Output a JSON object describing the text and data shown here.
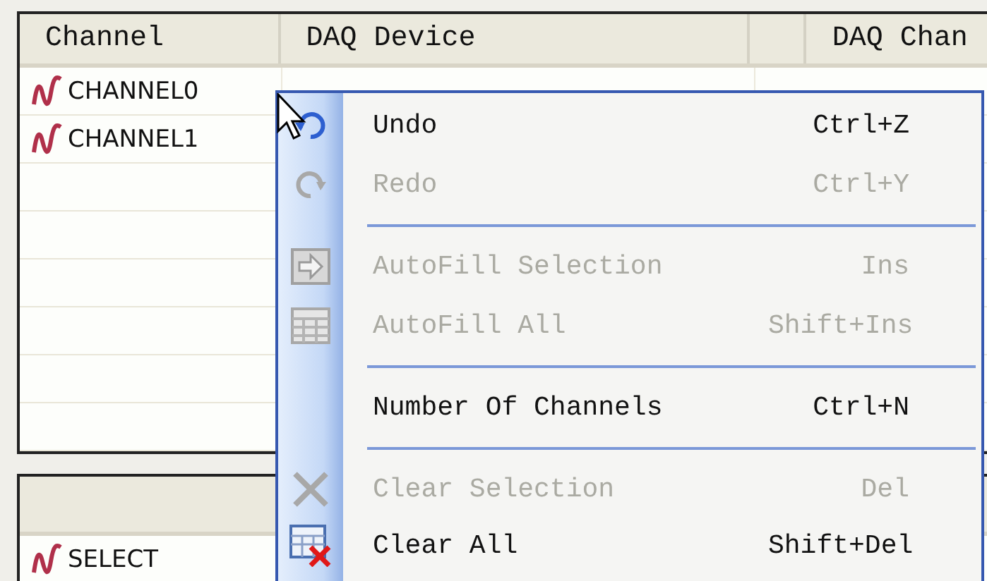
{
  "channel_table": {
    "columns": [
      "Channel",
      "DAQ Device",
      "",
      "DAQ Chan"
    ],
    "rows": [
      {
        "channel": "CHANNEL0"
      },
      {
        "channel": "CHANNEL1"
      }
    ]
  },
  "select_table": {
    "rows": [
      {
        "channel": "SELECT"
      }
    ]
  },
  "context_menu": {
    "items": [
      {
        "kind": "item",
        "label": "Undo",
        "shortcut": "Ctrl+Z",
        "disabled": false
      },
      {
        "kind": "item",
        "label": "Redo",
        "shortcut": "Ctrl+Y",
        "disabled": true
      },
      {
        "kind": "separator"
      },
      {
        "kind": "item",
        "label": "AutoFill Selection",
        "shortcut": "Ins",
        "disabled": true
      },
      {
        "kind": "item",
        "label": "AutoFill All",
        "shortcut": "Shift+Ins",
        "disabled": true
      },
      {
        "kind": "separator"
      },
      {
        "kind": "item",
        "label": "Number Of Channels",
        "shortcut": "Ctrl+N",
        "disabled": false
      },
      {
        "kind": "separator"
      },
      {
        "kind": "item",
        "label": "Clear Selection",
        "shortcut": "Del",
        "disabled": true
      },
      {
        "kind": "item",
        "label": "Clear All",
        "shortcut": "Shift+Del",
        "disabled": false
      }
    ]
  }
}
